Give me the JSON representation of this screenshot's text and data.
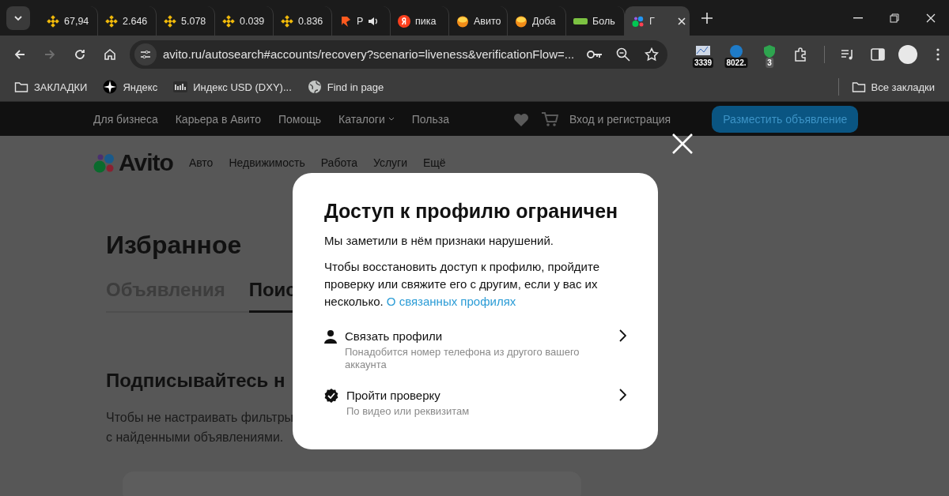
{
  "browser": {
    "tabs": [
      {
        "label": "67,94",
        "kind": "binance",
        "audio": false,
        "selected": false
      },
      {
        "label": "2.646",
        "kind": "binance",
        "audio": false,
        "selected": false
      },
      {
        "label": "5.078",
        "kind": "binance",
        "audio": false,
        "selected": false
      },
      {
        "label": "0.039",
        "kind": "binance",
        "audio": false,
        "selected": false
      },
      {
        "label": "0.836",
        "kind": "binance",
        "audio": false,
        "selected": false
      },
      {
        "label": "Р",
        "kind": "pikabu",
        "audio": true,
        "selected": false
      },
      {
        "label": "пика",
        "kind": "yandex",
        "audio": false,
        "selected": false
      },
      {
        "label": "Авито",
        "kind": "fruit",
        "audio": false,
        "selected": false
      },
      {
        "label": "Доба",
        "kind": "fruit",
        "audio": false,
        "selected": false
      },
      {
        "label": "Боль",
        "kind": "regional",
        "audio": false,
        "selected": false
      },
      {
        "label": "Г",
        "kind": "avito",
        "audio": false,
        "selected": true
      }
    ],
    "nav_buttons": [
      {
        "kind": "back",
        "disabled": false
      },
      {
        "kind": "forward",
        "disabled": true
      },
      {
        "kind": "reload",
        "disabled": false
      },
      {
        "kind": "home",
        "disabled": false
      }
    ],
    "url": "avito.ru/autosearch#accounts/recovery?scenario=liveness&verificationFlow=...",
    "extensions": [
      {
        "kind": "chart",
        "badge": "3339"
      },
      {
        "kind": "globe",
        "badge": "8022."
      },
      {
        "kind": "shield",
        "badge": "3"
      }
    ],
    "bookmarks": [
      {
        "kind": "folder",
        "label": "ЗАКЛАДКИ"
      },
      {
        "kind": "star",
        "label": "Яндекс"
      },
      {
        "kind": "inv",
        "label": "Индекс USD (DXY)..."
      },
      {
        "kind": "globe",
        "label": "Find in page"
      }
    ],
    "all_bookmarks": "Все закладки"
  },
  "site": {
    "top_nav": [
      {
        "label": "Для бизнеса",
        "dropdown": false
      },
      {
        "label": "Карьера в Авито",
        "dropdown": false
      },
      {
        "label": "Помощь",
        "dropdown": false
      },
      {
        "label": "Каталоги",
        "dropdown": true
      },
      {
        "label": "Польза",
        "dropdown": false
      }
    ],
    "login": "Вход и регистрация",
    "post_button": "Разместить объявление",
    "logo": "Avito",
    "categories": [
      "Авто",
      "Недвижимость",
      "Работа",
      "Услуги",
      "Ещё"
    ],
    "title": "Избранное",
    "tabs": [
      {
        "label": "Объявления",
        "selected": false
      },
      {
        "label": "Поис",
        "selected": true
      }
    ],
    "section_title": "Подписывайтесь н",
    "section_text": [
      "Чтобы не настраивать фильтры",
      "с найденными объявлениями."
    ]
  },
  "dialog": {
    "title": "Доступ к профилю ограничен",
    "subtitle": "Мы заметили в нём признаки нарушений.",
    "text": "Чтобы восстановить доступ к профилю, пройдите проверку или свяжите его с другим, если у вас их несколько.",
    "link": "О связанных профилях",
    "options": [
      {
        "kind": "person",
        "title": "Связать профили",
        "hint": "Понадобится номер телефона из другого вашего аккаунта"
      },
      {
        "kind": "verified",
        "title": "Пройти проверку",
        "hint": "По видео или реквизитам"
      }
    ]
  }
}
